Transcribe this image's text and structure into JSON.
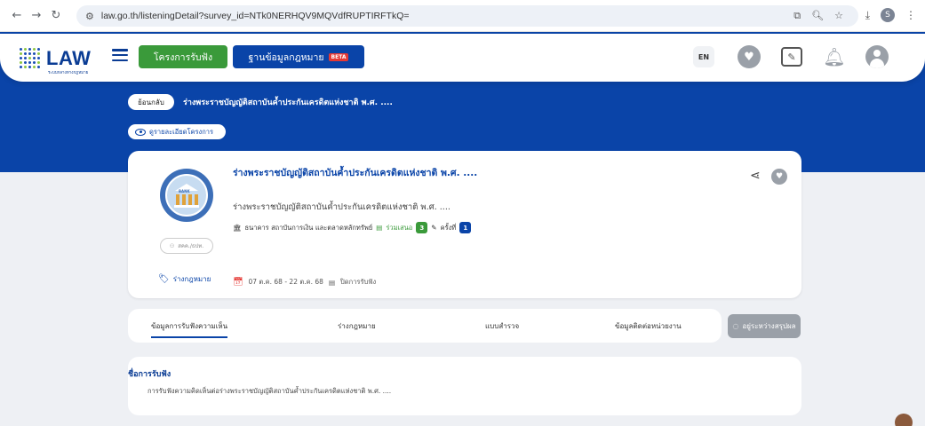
{
  "browser": {
    "url": "law.go.th/listeningDetail?survey_id=NTk0NERHQV9MQVdfRUPTIRFTkQ=",
    "profile_initial": "S"
  },
  "header": {
    "logo_text": "LAW",
    "logo_sub": "ระบบกลางทางกฎหมาย",
    "hearing_button": "โครงการรับฟัง",
    "lawdb_button": "ฐานข้อมูลกฎหมาย",
    "beta_badge": "BETA",
    "lang": "EN"
  },
  "breadcrumb": {
    "back": "ย้อนกลับ",
    "title": "ร่างพระราชบัญญัติสถาบันค้ำประกันเครดิตแห่งชาติ พ.ศ. ....",
    "detail_link": "ดูรายละเอียดโครงการ"
  },
  "card": {
    "title": "ร่างพระราชบัญญัติสถาบันค้ำประกันเครดิตแห่งชาติ พ.ศ. ....",
    "subtitle": "ร่างพระราชบัญญัติสถาบันค้ำประกันเครดิตแห่งชาติ พ.ศ. ....",
    "bank_label": "BANK",
    "category": "ธนาคาร สถาบันการเงิน และตลาดหลักทรัพย์",
    "join_label": "ร่วมเสนอ",
    "join_count": "3",
    "round_label": "ครั้งที่",
    "round_count": "1",
    "org": "สคค./ธปท.",
    "draft_link": "ร่างกฎหมาย",
    "date_range": "07 ต.ค. 68 - 22 ต.ค. 68",
    "status": "ปิดการรับฟัง"
  },
  "tabs": [
    {
      "label": "ข้อมูลการรับฟังความเห็น"
    },
    {
      "label": "ร่างกฎหมาย"
    },
    {
      "label": "แบบสำรวจ"
    },
    {
      "label": "ข้อมูลติดต่อหน่วยงาน"
    }
  ],
  "status_button": "อยู่ระหว่างสรุปผล",
  "info": {
    "title": "ชื่อการรับฟัง",
    "text": "การรับฟังความคิดเห็นต่อร่างพระราชบัญญัติสถาบันค้ำประกันเครดิตแห่งชาติ พ.ศ. ...."
  }
}
